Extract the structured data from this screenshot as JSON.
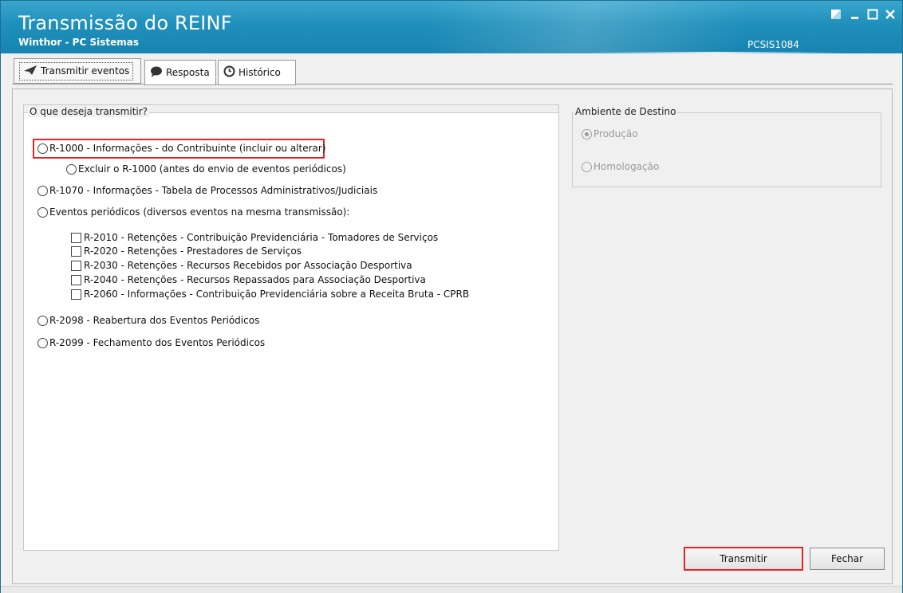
{
  "window": {
    "title": "Transmissão do REINF",
    "subtitle": "Winthor - PC Sistemas",
    "code": "PCSIS1084",
    "controls": {
      "restore": "▣",
      "minimize": "_",
      "maximize": "☐",
      "close": "✕"
    }
  },
  "tabs": [
    {
      "label": "Transmitir eventos",
      "icon": "paper-plane-icon",
      "active": true
    },
    {
      "label": "Resposta",
      "icon": "speech-bubble-icon",
      "active": false
    },
    {
      "label": "Histórico",
      "icon": "clock-icon",
      "active": false
    }
  ],
  "transmit_group": {
    "title": "O que deseja transmitir?",
    "options": [
      {
        "label": "R-1000 - Informações - do Contribuinte (incluir ou alterar)",
        "selected": false,
        "highlighted": true
      },
      {
        "label": "Excluir o R-1000 (antes do envio de eventos periódicos)",
        "selected": false
      },
      {
        "label": "R-1070 - Informações - Tabela de Processos Administrativos/Judiciais",
        "selected": false
      },
      {
        "label": "Eventos periódicos (diversos eventos na mesma transmissão):",
        "selected": false
      }
    ],
    "periodic_events": [
      {
        "label": "R-2010 - Retenções - Contribuição Previdenciária - Tomadores de Serviços",
        "checked": false
      },
      {
        "label": "R-2020 - Retenções - Prestadores de Serviços",
        "checked": false
      },
      {
        "label": "R-2030 - Retenções - Recursos Recebidos por Associação Desportiva",
        "checked": false
      },
      {
        "label": "R-2040 - Retenções - Recursos Repassados para Associação Desportiva",
        "checked": false
      },
      {
        "label": "R-2060 - Informações - Contribuição Previdenciária sobre a Receita Bruta - CPRB",
        "checked": false
      }
    ],
    "closing_options": [
      {
        "label": "R-2098 - Reabertura dos Eventos Periódicos",
        "selected": false
      },
      {
        "label": "R-2099 - Fechamento dos Eventos Periódicos",
        "selected": false
      }
    ]
  },
  "environment_group": {
    "title": "Ambiente de Destino",
    "options": [
      {
        "label": "Produção",
        "selected": true,
        "disabled": true
      },
      {
        "label": "Homologação",
        "selected": false,
        "disabled": true
      }
    ]
  },
  "buttons": {
    "transmit": "Transmitir",
    "close": "Fechar"
  },
  "colors": {
    "titlebar": "#1f8fbb",
    "highlight": "#e02626"
  }
}
